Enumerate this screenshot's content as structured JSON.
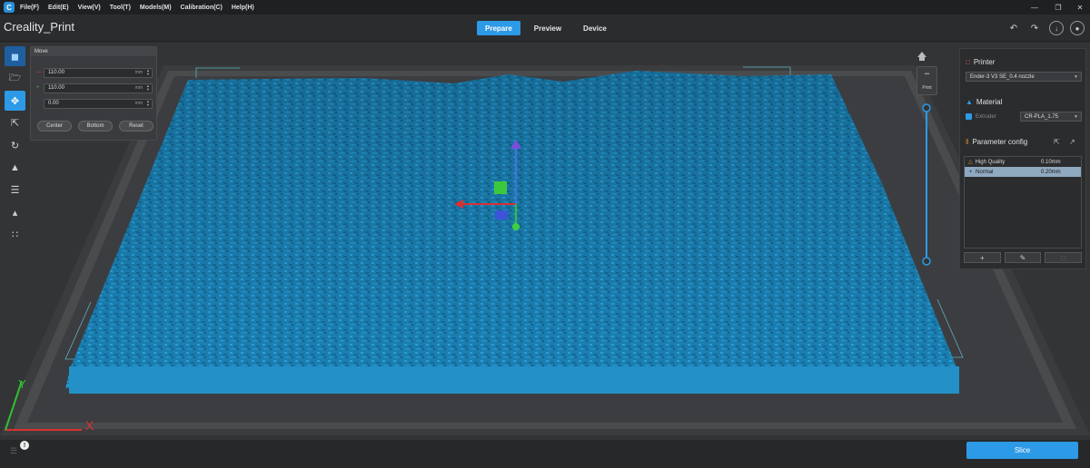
{
  "menubar": {
    "items": [
      "File(F)",
      "Edit(E)",
      "View(V)",
      "Tool(T)",
      "Models(M)",
      "Calibration(C)",
      "Help(H)"
    ]
  },
  "app": {
    "title": "Creality_Print"
  },
  "tabs": [
    {
      "label": "Prepare",
      "active": true
    },
    {
      "label": "Preview",
      "active": false
    },
    {
      "label": "Device",
      "active": false
    }
  ],
  "move_panel": {
    "title": "Move",
    "x_value": "110.00",
    "y_value": "110.00",
    "z_value": "0.00",
    "unit": "mm",
    "buttons": [
      "Center",
      "Bottom",
      "Reset"
    ]
  },
  "right_panel": {
    "printer_label": "Printer",
    "printer_value": "Ender-3 V3 SE_0.4 nozzle",
    "material_label": "Material",
    "extruder_label": "Extruder",
    "material_value": "CR-PLA_1.75",
    "param_label": "Parameter config",
    "profiles": [
      {
        "name": "High Quality",
        "value": "0.10mm",
        "selected": false
      },
      {
        "name": "Normal",
        "value": "0.20mm",
        "selected": true
      }
    ]
  },
  "layer_box": {
    "label": "Print"
  },
  "slice_button": "Slice",
  "colors": {
    "accent": "#2c9ae6",
    "model": "#1f86b8",
    "background": "#2b2c2e"
  }
}
